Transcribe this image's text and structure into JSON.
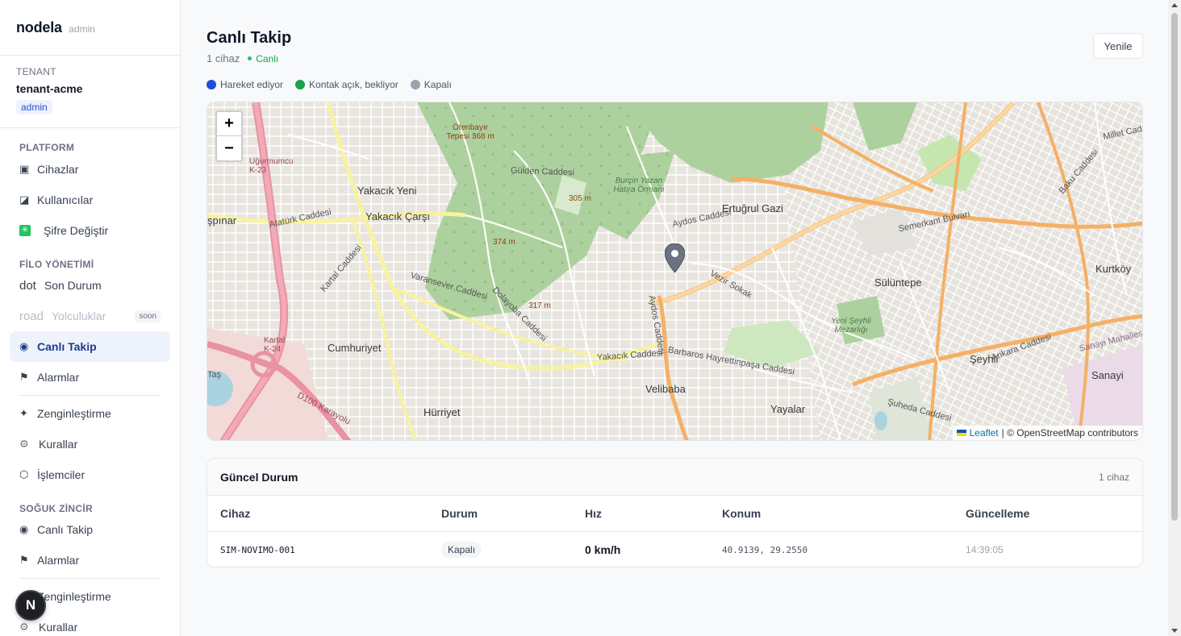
{
  "brand": {
    "name": "nodela",
    "role": "admin"
  },
  "tenant": {
    "label": "TENANT",
    "name": "tenant-acme",
    "badge": "admin"
  },
  "nav": {
    "platform": {
      "label": "PLATFORM",
      "items": [
        {
          "label": "Cihazlar",
          "icon": "device-icon"
        },
        {
          "label": "Kullanıcılar",
          "icon": "users-icon"
        },
        {
          "label": "Şifre Değiştir",
          "icon": "sparkle-icon"
        }
      ]
    },
    "fleet": {
      "label": "FİLO YÖNETİMİ",
      "son_durum_prefix": "dot",
      "son_durum": "Son Durum",
      "trips_prefix": "road",
      "trips": "Yolculuklar",
      "trips_badge": "soon",
      "live": "Canlı Takip",
      "alarms": "Alarmlar",
      "enrichment": "Zenginleştirme",
      "rules": "Kurallar",
      "processors": "İşlemciler"
    },
    "cold": {
      "label": "SOĞUK ZİNCİR",
      "live": "Canlı Takip",
      "alarms": "Alarmlar",
      "enrichment": "Zenginleştirme",
      "rules": "Kurallar"
    }
  },
  "fab": {
    "letter": "N"
  },
  "page": {
    "title": "Canlı Takip",
    "device_count": "1 cihaz",
    "live_status": "Canlı",
    "refresh": "Yenile"
  },
  "legend": [
    {
      "label": "Hareket ediyor",
      "color": "#1d4ed8"
    },
    {
      "label": "Kontak açık, bekliyor",
      "color": "#16a34a"
    },
    {
      "label": "Kapalı",
      "color": "#9ca3af"
    }
  ],
  "map": {
    "zoom_in": "+",
    "zoom_out": "−",
    "attribution_leaflet": "Leaflet",
    "attribution_rest": "| © OpenStreetMap contributors",
    "labels": {
      "yakacik_yeni": "Yakacık Yeni",
      "yakacik_carsi": "Yakacık Çarşı",
      "cumhuriyet": "Cumhuriyet",
      "hurriyet": "Hürriyet",
      "velibaba": "Velibaba",
      "yayalar": "Yayalar",
      "seyhli": "Şeyhli",
      "sanayi": "Sanayi",
      "suluntepe": "Sülüntepe",
      "kurtkoy": "Kurtköy",
      "ertugrul_gazi": "Ertuğrul Gazi",
      "aydos_caddesi": "Aydos Caddesi",
      "aydos_caddesi_2": "Aydos Caddesi",
      "yakacik_caddesi": "Yakacık Caddesi",
      "ankara_caddesi": "Ankara Caddesi",
      "semerkant_bulvari": "Semerkant Bulvarı",
      "gulden_caddesi": "Gülden Caddesi",
      "ataturk_caddesi": "Atatürk Caddesi",
      "barbaros": "Barbaros Hayrettinpaşa Caddesi",
      "varansever": "Varansever Caddesi",
      "kartal_caddesi": "Kartal Caddesi",
      "dolayoba": "Dolayoba Caddesi",
      "vezir_sokak": "Vezir Sokak",
      "otenbayir": "Ötenbayır Tepesi 368 m",
      "h305": "305 m",
      "h374": "374 m",
      "h317": "317 m",
      "burcin": "Burçin Yazan Hatıra Ormanı",
      "yeni_seyhli": "Yeni Şeyhli Mezarlığı",
      "sanayi_mah": "Sanayi Mahallesi",
      "kartal_k24": "Kartal K-24",
      "ugurmumcu": "Uğurmumcu K-23",
      "spinar": "şpınar",
      "tas": "Taş",
      "d100": "D100 Karayolu",
      "millet_caddesi": "Millet Caddesi",
      "baku_caddesi": "Baku Caddesi",
      "sehitler": "Şuheda Caddesi"
    }
  },
  "status_card": {
    "title": "Güncel Durum",
    "count": "1 cihaz",
    "columns": [
      "Cihaz",
      "Durum",
      "Hız",
      "Konum",
      "Güncelleme"
    ],
    "rows": [
      {
        "device": "SIM-NOVIMO-001",
        "status": "Kapalı",
        "speed": "0 km/h",
        "location": "40.9139, 29.2550",
        "updated": "14:39:05"
      }
    ]
  }
}
